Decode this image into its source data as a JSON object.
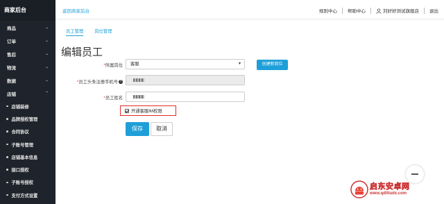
{
  "sidebar": {
    "brand": "商家后台",
    "menu": [
      {
        "label": "商品",
        "chevron": "⌄"
      },
      {
        "label": "订单",
        "chevron": "⌄"
      },
      {
        "label": "售后",
        "chevron": "⌄"
      },
      {
        "label": "物流",
        "chevron": "⌄"
      },
      {
        "label": "数据",
        "chevron": "⌄"
      },
      {
        "label": "店铺",
        "chevron": "⌃"
      }
    ],
    "submenu": [
      {
        "label": "店铺装修"
      },
      {
        "label": "品牌授权管理"
      },
      {
        "label": "合同协议"
      },
      {
        "label": "子账号管理"
      },
      {
        "label": "店铺基本信息"
      },
      {
        "label": "接口授权"
      },
      {
        "label": "子账号授权"
      },
      {
        "label": "支付方式设置"
      }
    ]
  },
  "header": {
    "back_link": "返回商家后台",
    "rules": "规则中心",
    "help": "帮助中心",
    "user": "刘好好测试旗舰店",
    "logout": "退出"
  },
  "tabs": [
    {
      "label": "员工管理",
      "active": true
    },
    {
      "label": "岗位管理",
      "active": false
    }
  ],
  "form": {
    "title": "编辑员工",
    "position_label": "所属岗位",
    "position_value": "客服",
    "create_position_button": "创建新岗位",
    "phone_label": "员工头条注册手机号",
    "name_label": "员工姓名",
    "im_checkbox_label": "开通客服IM权限",
    "im_checked": true,
    "save_button": "保存",
    "cancel_button": "取消",
    "required_mark": "*"
  },
  "watermark": {
    "brand_cn": "启东安卓网",
    "url": "www.qdlttudx.com"
  },
  "colors": {
    "sidebar_bg": "#1f232b",
    "accent": "#1e9fd8",
    "highlight_border": "#e02a2a",
    "watermark": "#cc3333"
  },
  "icons": {
    "help": "question-circle-icon",
    "user": "user-icon",
    "chevron": "chevron-icon",
    "dropdown": "caret-down-icon"
  }
}
